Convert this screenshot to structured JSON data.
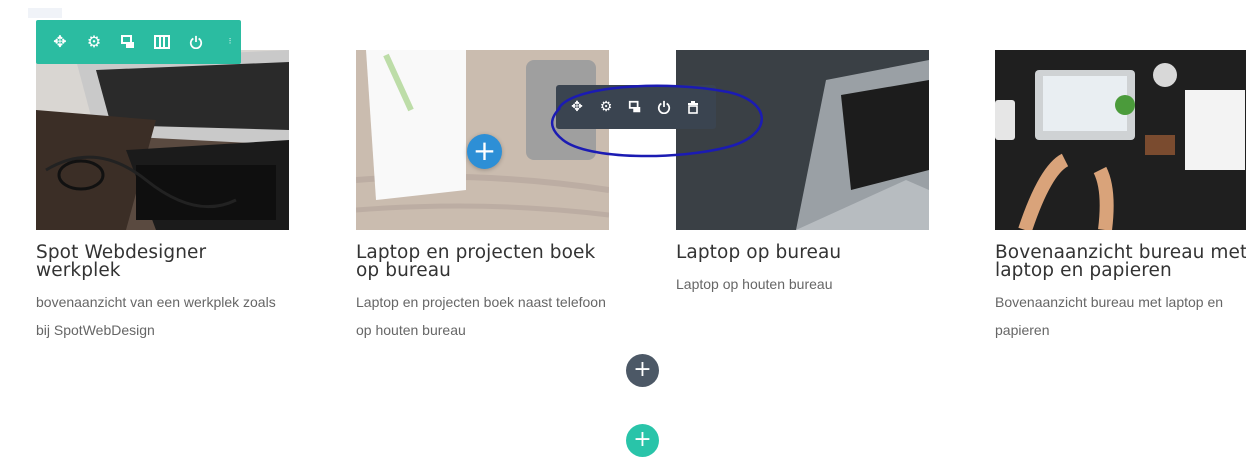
{
  "cards": [
    {
      "title": "Spot Webdesigner werkplek",
      "description": "bovenaanzicht van een werkplek zoals bij SpotWebDesign",
      "image": "laptop-and-glasses-photo"
    },
    {
      "title": "Laptop en projecten boek op bureau",
      "description": "Laptop en projecten boek naast telefoon op houten bureau",
      "image": "notebook-on-wooden-desk-photo"
    },
    {
      "title": "Laptop op bureau",
      "description": "Laptop op houten bureau",
      "image": "laptop-on-dark-desk-photo"
    },
    {
      "title": "Bovenaanzicht bureau met laptop en papieren",
      "description": "Bovenaanzicht bureau met laptop en papieren",
      "image": "desk-topview-photo"
    }
  ],
  "row_toolbar": {
    "color": "#2bbca1",
    "icons": [
      "move-icon",
      "settings-icon",
      "duplicate-icon",
      "columns-icon",
      "power-icon",
      "more-icon"
    ]
  },
  "module_toolbar": {
    "color": "#3a4450",
    "icons": [
      "move-icon",
      "settings-icon",
      "duplicate-icon",
      "power-icon",
      "delete-icon"
    ]
  },
  "add_buttons": {
    "module_plus": "+",
    "row_plus": "+",
    "section_plus": "+"
  },
  "colors": {
    "annotation": "#1b1bb3",
    "add_module": "#2d8fd6",
    "add_row": "#4c5866",
    "add_section": "#29c4a9"
  }
}
